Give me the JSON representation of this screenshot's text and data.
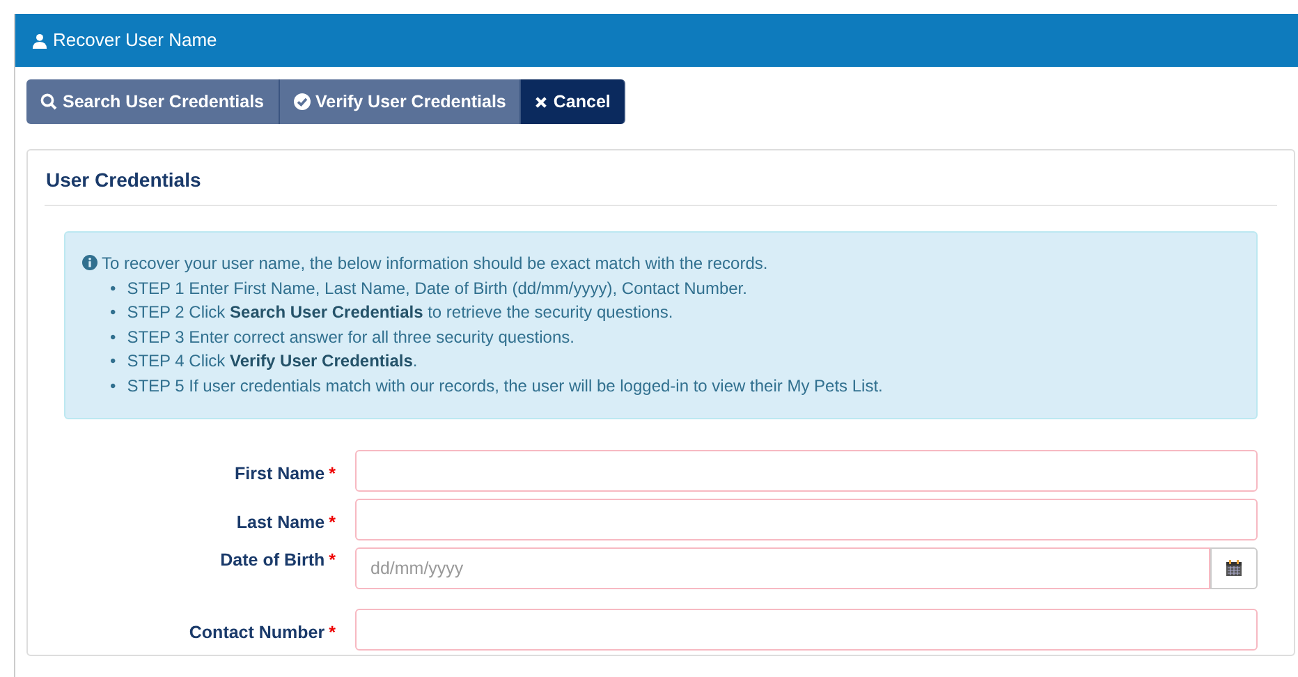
{
  "header": {
    "title": "Recover User Name"
  },
  "toolbar": [
    {
      "label": "Search User Credentials",
      "kind": "search"
    },
    {
      "label": "Verify User Credentials",
      "kind": "verify"
    },
    {
      "label": "Cancel",
      "kind": "cancel"
    }
  ],
  "card": {
    "title": "User Credentials",
    "info": {
      "intro": "To recover your user name, the below information should be exact match with the records.",
      "steps": [
        {
          "bullet": "•",
          "text": "STEP 1 Enter First Name, Last Name, Date of Birth (dd/mm/yyyy), Contact Number."
        },
        {
          "bullet": "•",
          "text": "STEP 2 Click **Search User Credentials** to retrieve the security questions."
        },
        {
          "bullet": "•",
          "text": "STEP 3 Enter correct answer for all three security questions."
        },
        {
          "bullet": "•",
          "text": "STEP 4 Click **Verify User Credentials**."
        },
        {
          "bullet": "•",
          "text": "STEP 5 If user credentials match with our records, the user will be logged-in to view their My Pets List."
        }
      ]
    },
    "fields": [
      {
        "label": "First Name",
        "required_mark": "*",
        "kind": "text"
      },
      {
        "label": "Last Name",
        "required_mark": "*",
        "kind": "text"
      },
      {
        "label": "Date of Birth",
        "required_mark": "*",
        "kind": "date",
        "placeholder": "dd/mm/yyyy"
      },
      {
        "label": "Contact Number",
        "required_mark": "*",
        "kind": "text"
      }
    ]
  }
}
